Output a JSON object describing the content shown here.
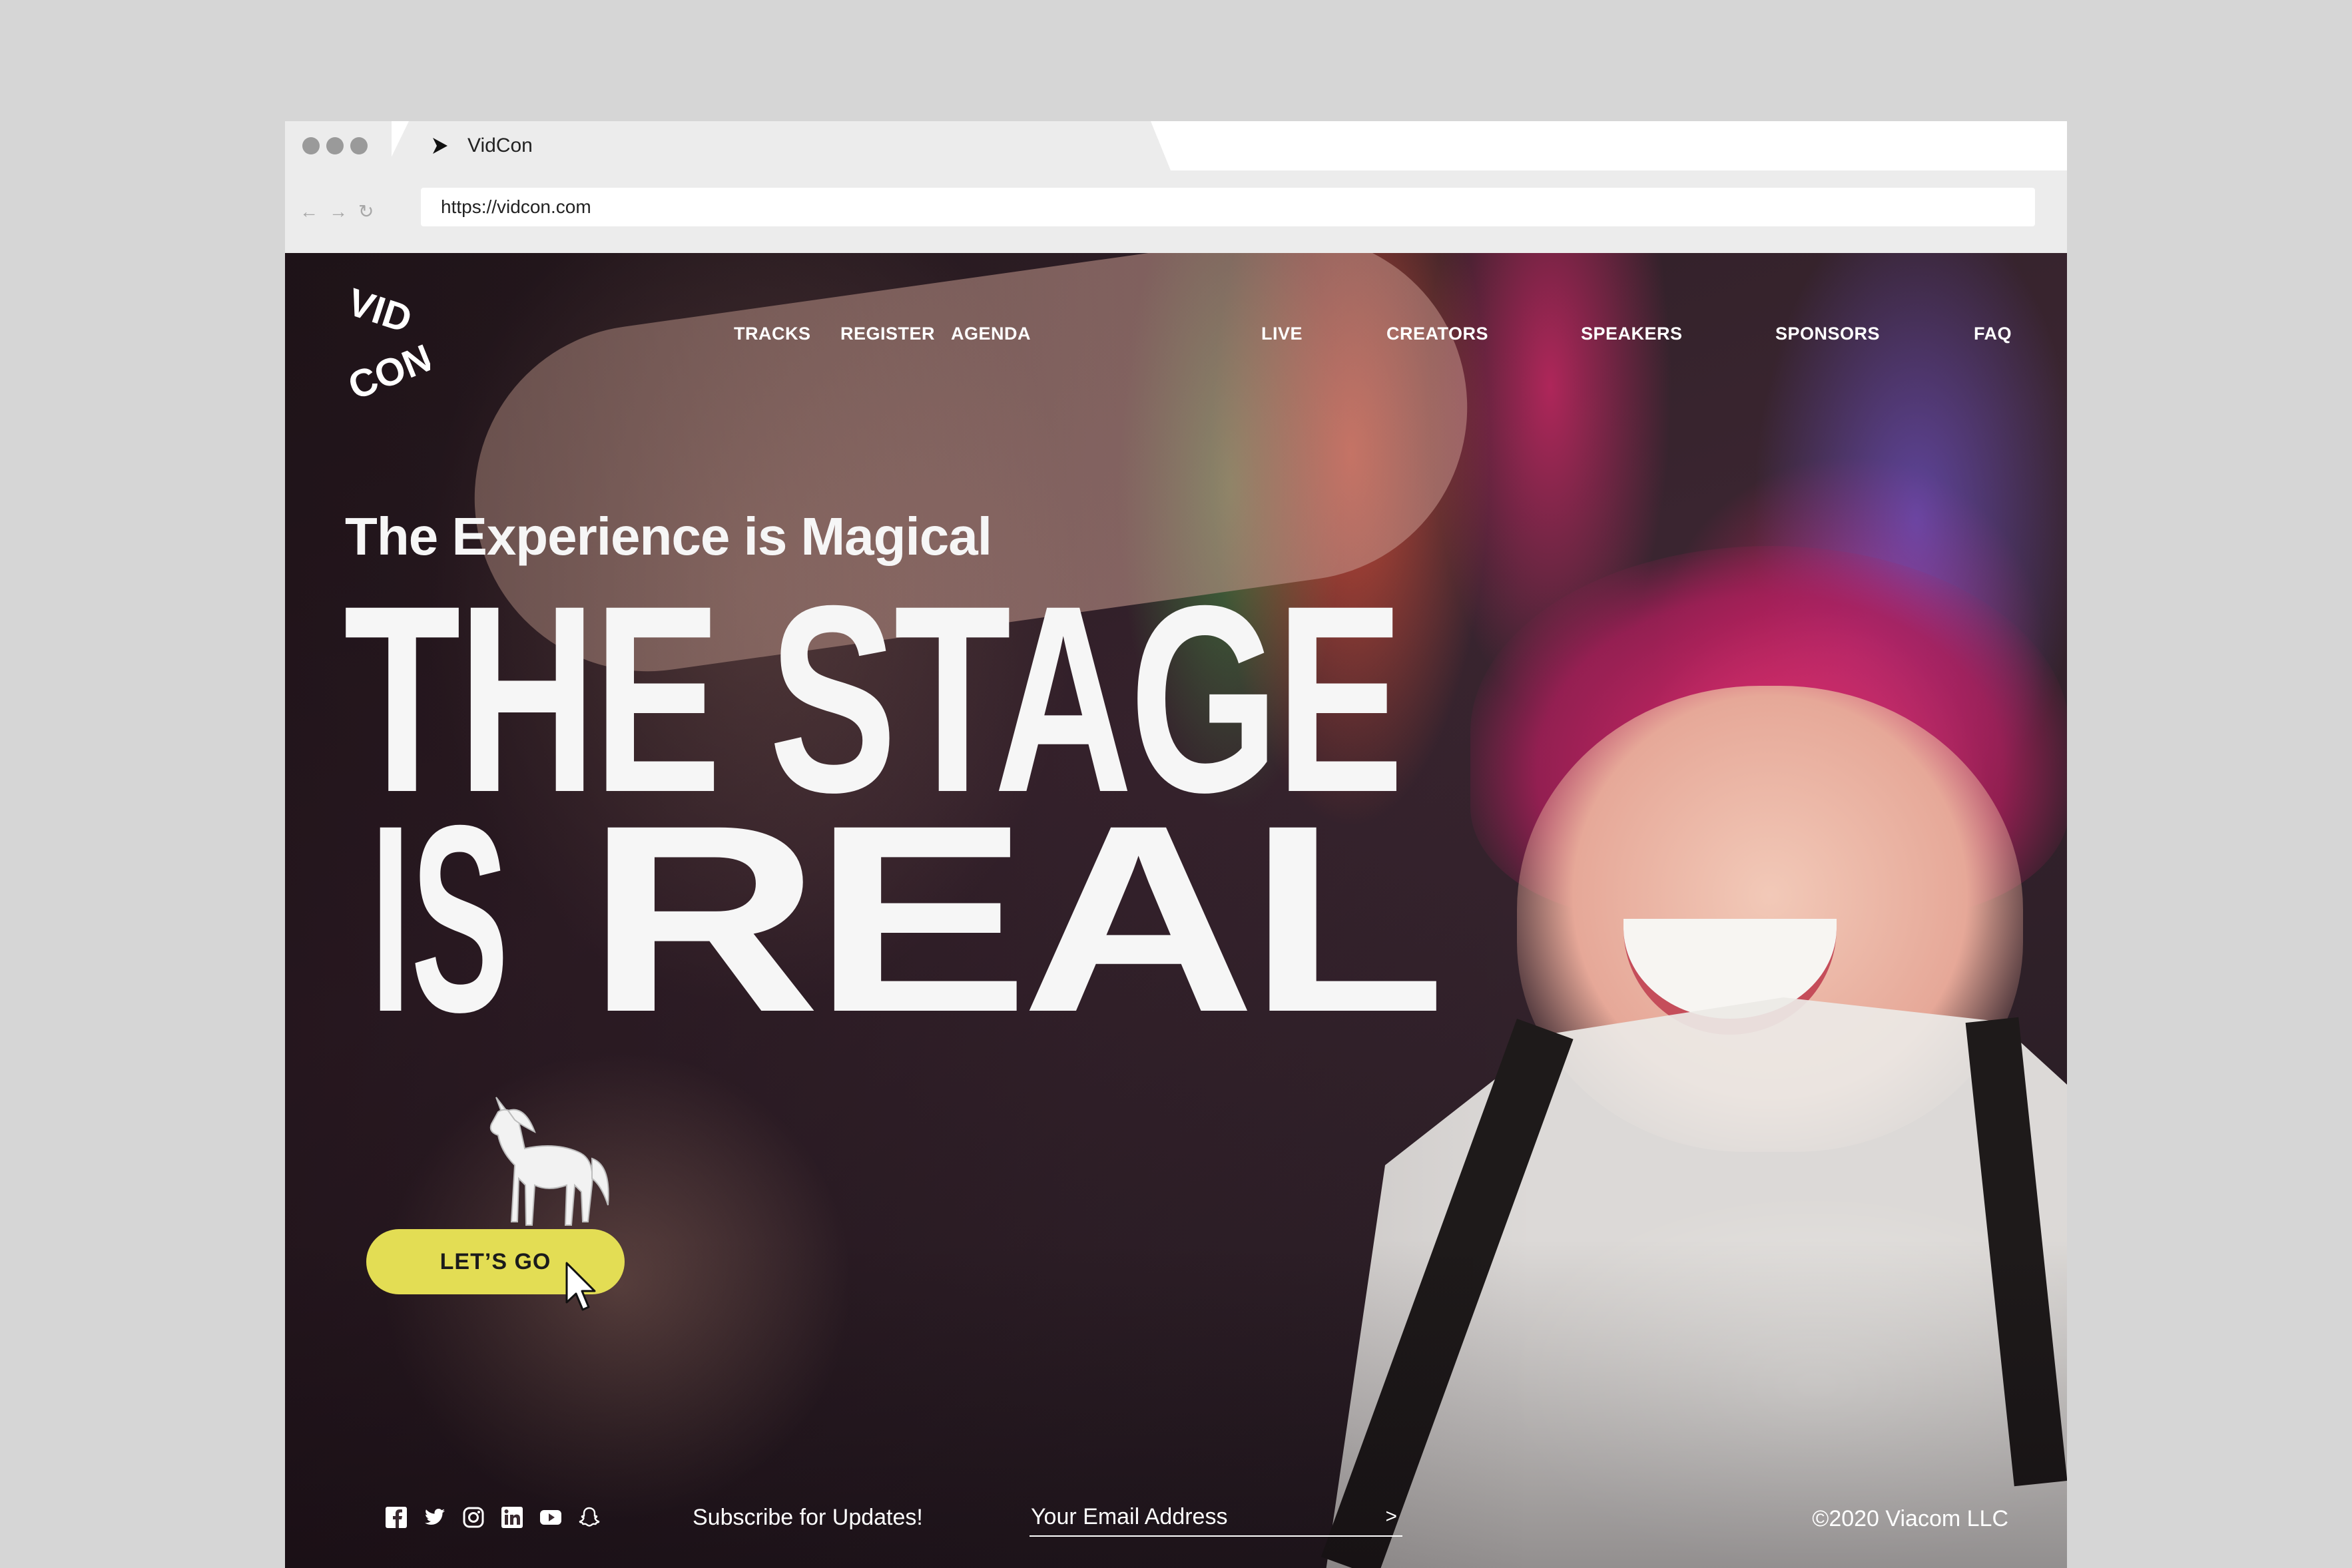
{
  "browser": {
    "tab_title": "VidCon",
    "url": "https://vidcon.com",
    "nav_icons": [
      "back-arrow-icon",
      "forward-arrow-icon",
      "reload-icon"
    ]
  },
  "site": {
    "logo": {
      "line1": "VID",
      "line2": "CON"
    },
    "nav": [
      "TRACKS",
      "REGISTER",
      "AGENDA",
      "LIVE",
      "CREATORS",
      "SPEAKERS",
      "SPONSORS",
      "FAQ"
    ]
  },
  "hero": {
    "kicker": "The Experience is Magical",
    "headline_line1": "THE STAGE",
    "headline_is": "IS",
    "headline_real": "REAL",
    "cta_label": "LET’S GO"
  },
  "footer": {
    "social_icons": [
      "facebook-icon",
      "twitter-icon",
      "instagram-icon",
      "linkedin-icon",
      "youtube-icon",
      "snapchat-icon"
    ],
    "subscribe_label": "Subscribe for Updates!",
    "email_placeholder": "Your Email Address",
    "submit_glyph": ">",
    "copyright": "©2020 Viacom LLC"
  },
  "colors": {
    "cta": "#e3dd54",
    "chrome": "#ececec",
    "backdrop": "#d6d6d6",
    "text_light": "#f6f6f6"
  }
}
